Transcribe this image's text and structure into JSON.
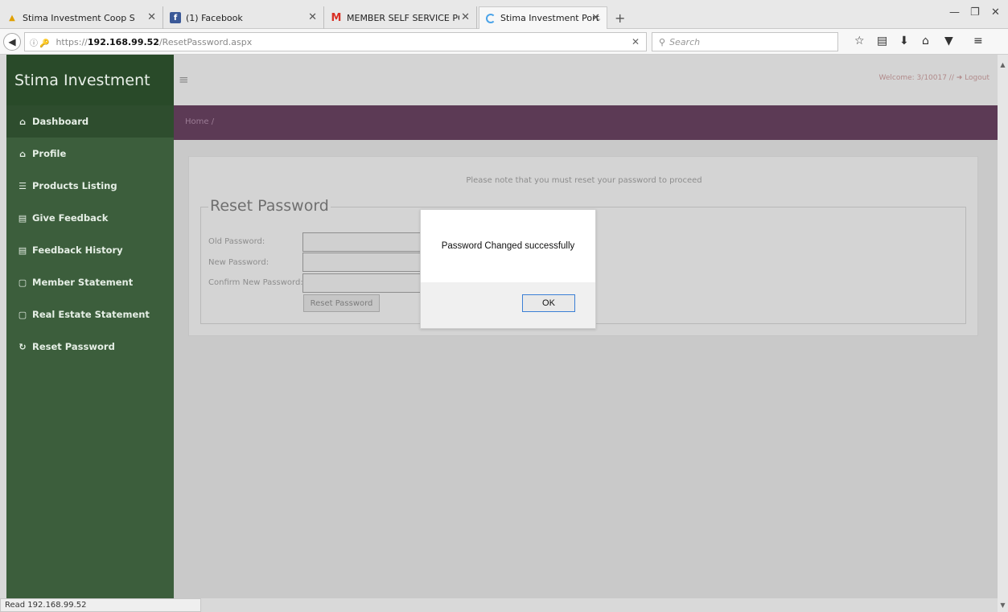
{
  "browser": {
    "tabs": [
      {
        "label": "Stima Investment Coop Soci",
        "icon": "stima-favicon"
      },
      {
        "label": "(1) Facebook",
        "icon": "facebook-favicon"
      },
      {
        "label": "MEMBER SELF SERVICE PORT",
        "icon": "gmail-favicon"
      },
      {
        "label": "Stima Investment Portal",
        "icon": "loading-favicon"
      }
    ],
    "url": {
      "proto": "https://",
      "host": "192.168.99.52",
      "path": "/ResetPassword.aspx"
    },
    "search_placeholder": "Search",
    "status_text": "Read 192.168.99.52"
  },
  "app": {
    "brand": "Stima Investment",
    "welcome": "Welcome: 3/10017 //",
    "logout_label": "Logout",
    "breadcrumb": "Home /",
    "menu": [
      {
        "label": "Dashboard",
        "icon": "dashboard-icon"
      },
      {
        "label": "Profile",
        "icon": "profile-icon"
      },
      {
        "label": "Products Listing",
        "icon": "list-icon"
      },
      {
        "label": "Give Feedback",
        "icon": "feedback-icon"
      },
      {
        "label": "Feedback History",
        "icon": "history-icon"
      },
      {
        "label": "Member Statement",
        "icon": "document-icon"
      },
      {
        "label": "Real Estate Statement",
        "icon": "document-icon"
      },
      {
        "label": "Reset Password",
        "icon": "refresh-icon"
      }
    ]
  },
  "form": {
    "notice": "Please note that you must reset your password to proceed",
    "title": "Reset Password",
    "old_password_label": "Old Password:",
    "new_password_label": "New Password:",
    "confirm_password_label": "Confirm New Password:",
    "submit_label": "Reset Password"
  },
  "dialog": {
    "message": "Password Changed successfully",
    "ok_label": "OK"
  }
}
